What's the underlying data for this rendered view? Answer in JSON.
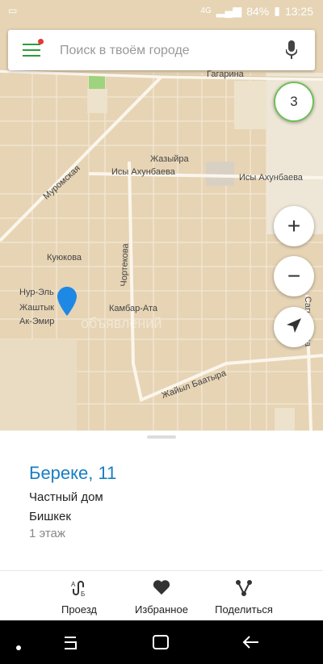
{
  "status_bar": {
    "network": "4G",
    "battery": "84%",
    "time": "13:25"
  },
  "search": {
    "placeholder": "Поиск в твоём городе"
  },
  "map": {
    "layer_count": "3",
    "zoom_in": "+",
    "zoom_out": "−",
    "streets": {
      "gagarina": "Гагарина",
      "zhazyira": "Жазыйра",
      "isy1": "Исы Ахунбаева",
      "isy2": "Исы Ахунбаева",
      "muromskaya": "Муромская",
      "kuyukova": "Куюкова",
      "chortekova": "Чортекова",
      "kambar_ata": "Камбар-Ата",
      "zhaiyl_baatyra": "Жайыл Баатыра",
      "sagynbaeva": "Сагынбаева",
      "nur_el": "Нур-Эль",
      "zhashtyk": "Жаштык",
      "ak_emir": "Ак-Эмир"
    },
    "watermark": "объявлений"
  },
  "place": {
    "title": "Береке, 11",
    "type": "Частный дом",
    "city": "Бишкек",
    "floors": "1 этаж"
  },
  "actions": {
    "route": "Проезд",
    "favorite": "Избранное",
    "share": "Поделиться"
  },
  "colors": {
    "accent_green": "#2e9c3a",
    "title_blue": "#1a7ec2",
    "map_bg": "#e6d4b5",
    "pin_blue": "#1e88e5"
  }
}
